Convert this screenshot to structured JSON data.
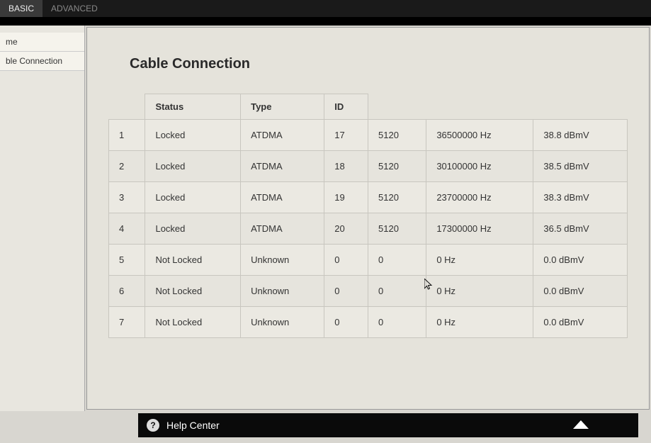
{
  "tabs": {
    "basic": "BASIC",
    "advanced": "ADVANCED"
  },
  "sidebar": {
    "items": [
      {
        "label": "me"
      },
      {
        "label": "ble Connection"
      }
    ]
  },
  "page": {
    "title": "Cable Connection"
  },
  "table": {
    "headers": {
      "index": "",
      "status": "Status",
      "type": "Type",
      "id": "ID",
      "col5": "",
      "col6": "",
      "col7": ""
    },
    "rows": [
      {
        "index": "1",
        "status": "Locked",
        "type": "ATDMA",
        "id": "17",
        "col5": "5120",
        "col6": "36500000 Hz",
        "col7": "38.8 dBmV"
      },
      {
        "index": "2",
        "status": "Locked",
        "type": "ATDMA",
        "id": "18",
        "col5": "5120",
        "col6": "30100000 Hz",
        "col7": "38.5 dBmV"
      },
      {
        "index": "3",
        "status": "Locked",
        "type": "ATDMA",
        "id": "19",
        "col5": "5120",
        "col6": "23700000 Hz",
        "col7": "38.3 dBmV"
      },
      {
        "index": "4",
        "status": "Locked",
        "type": "ATDMA",
        "id": "20",
        "col5": "5120",
        "col6": "17300000 Hz",
        "col7": "36.5 dBmV"
      },
      {
        "index": "5",
        "status": "Not Locked",
        "type": "Unknown",
        "id": "0",
        "col5": "0",
        "col6": "0 Hz",
        "col7": "0.0 dBmV"
      },
      {
        "index": "6",
        "status": "Not Locked",
        "type": "Unknown",
        "id": "0",
        "col5": "0",
        "col6": "0 Hz",
        "col7": "0.0 dBmV"
      },
      {
        "index": "7",
        "status": "Not Locked",
        "type": "Unknown",
        "id": "0",
        "col5": "0",
        "col6": "0 Hz",
        "col7": "0.0 dBmV"
      }
    ]
  },
  "footer": {
    "help_label": "Help Center"
  }
}
